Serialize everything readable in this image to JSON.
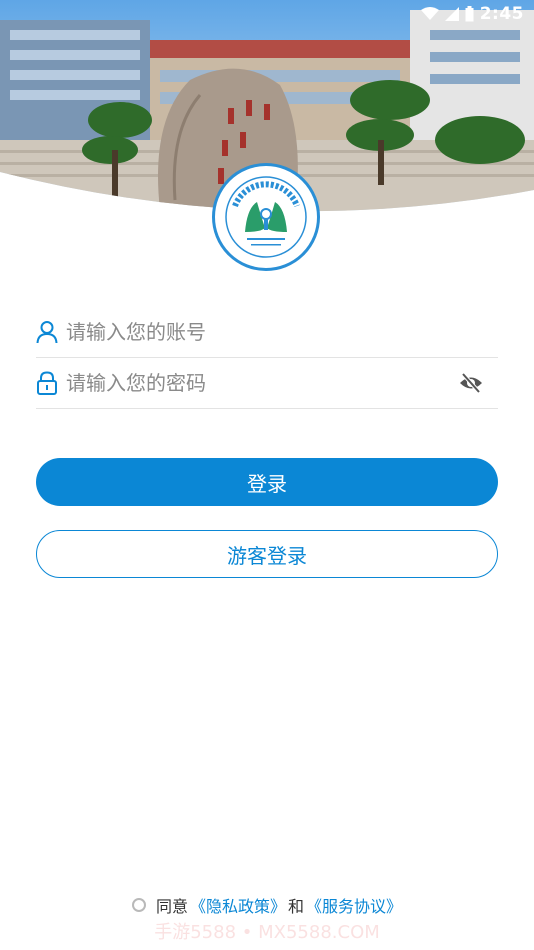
{
  "status_bar": {
    "time": "2:45",
    "icons": [
      "wifi-icon",
      "signal-icon",
      "battery-icon"
    ]
  },
  "login": {
    "username_placeholder": "请输入您的账号",
    "password_placeholder": "请输入您的密码",
    "login_label": "登录",
    "guest_label": "游客登录"
  },
  "agreement": {
    "prefix": "同意",
    "privacy": "《隐私政策》",
    "and": "和",
    "service": "《服务协议》"
  },
  "watermark": "手游5588 • MX5588.COM",
  "colors": {
    "accent": "#0b87d5",
    "divider": "#e3e3e3",
    "placeholder": "#8a8a8a"
  }
}
